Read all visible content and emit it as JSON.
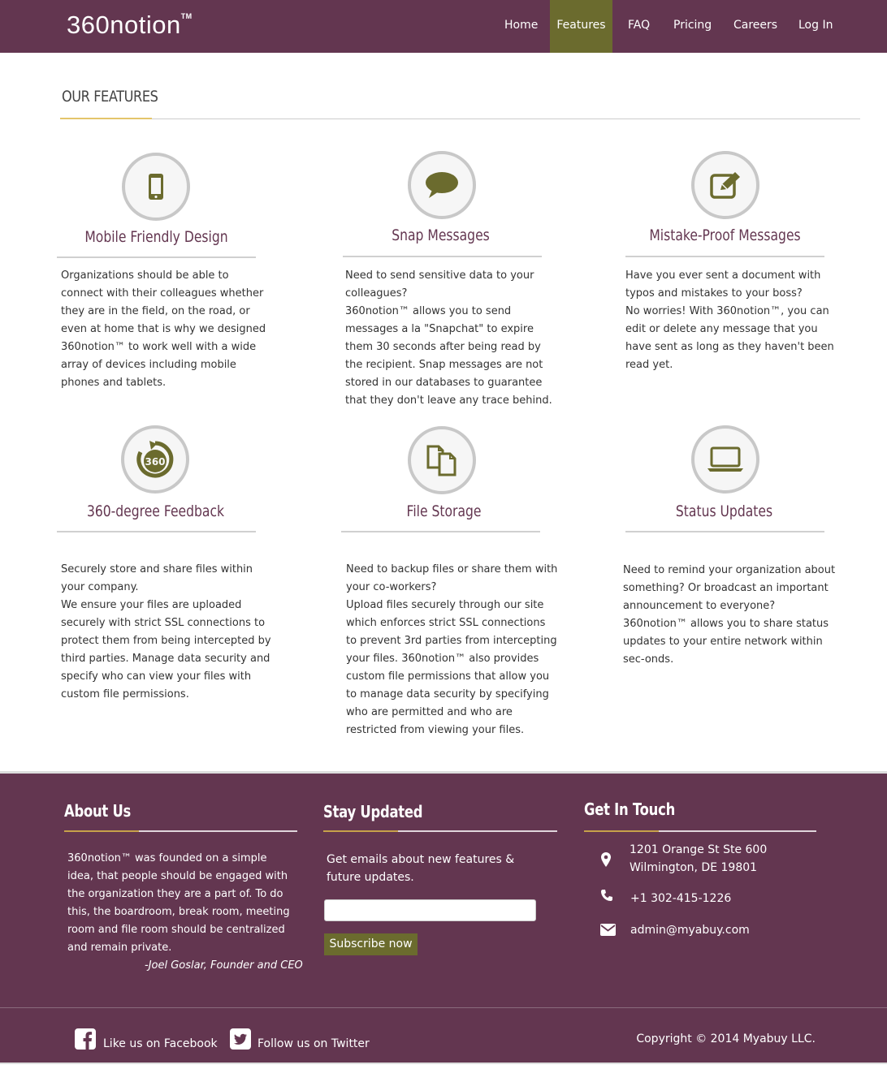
{
  "header": {
    "logo_text": "360notion",
    "logo_tm": "TM",
    "nav": [
      {
        "label": "Home"
      },
      {
        "label": "Features",
        "active": true
      },
      {
        "label": "FAQ"
      },
      {
        "label": "Pricing"
      },
      {
        "label": "Careers"
      },
      {
        "label": "Log In"
      }
    ]
  },
  "section_title": "OUR FEATURES",
  "features": [
    {
      "icon": "mobile-icon",
      "title": "Mobile Friendly Design",
      "text": [
        "Organizations should be able to connect with their colleagues whether they are in the field, on the road, or even at home that is why we designed 360notion™ to work well with a wide array of devices including mobile phones and tablets."
      ]
    },
    {
      "icon": "chat-bubble-icon",
      "title": "Snap Messages",
      "text": [
        "Need to send sensitive data to your colleagues?",
        "360notion™ allows you to send messages a la \"Snapchat\" to expire them 30 seconds after being read by the recipient. Snap messages are not stored in our databases to guarantee that they don't leave any trace behind."
      ]
    },
    {
      "icon": "edit-icon",
      "title": "Mistake-Proof Messages",
      "text": [
        "Have you ever sent a document with typos and mistakes to your boss?",
        "No worries! With 360notion™, you can edit or delete any message that you have sent as long as they haven't been read yet."
      ]
    },
    {
      "icon": "360-feedback-icon",
      "title": "360-degree Feedback",
      "text": [
        "Securely store and share files within your company.",
        "We ensure your files are uploaded securely with strict SSL connections to protect them from being intercepted by third parties. Manage data security and specify who can view your files with custom file permissions."
      ]
    },
    {
      "icon": "files-icon",
      "title": "File Storage",
      "text": [
        "Need to backup files or share them with your co-workers?",
        "Upload files securely through our site which enforces strict SSL connections to prevent 3rd parties from intercepting your files. 360notion™ also provides custom file permissions that allow you to manage data security by specifying who are permitted and who are restricted from viewing your files."
      ]
    },
    {
      "icon": "laptop-icon",
      "title": "Status Updates",
      "text": [
        "Need to remind your organization about something? Or broadcast an important announcement to everyone?",
        "360notion™ allows you to share status updates to your entire network within sec-onds."
      ]
    }
  ],
  "footer": {
    "about": {
      "title": "About Us",
      "text": "360notion™ was founded on a simple idea, that people should be engaged with the organization they are a part of. To do this, the boardroom, break room, meeting room and file room should be centralized and remain private.",
      "signature": "-Joel Goslar, Founder and CEO"
    },
    "updates": {
      "title": "Stay Updated",
      "text": "Get emails about new features & future updates.",
      "email_value": "",
      "button": "Subscribe now"
    },
    "contact": {
      "title": "Get In Touch",
      "address_line1": "1201 Orange St Ste 600",
      "address_line2": "Wilmington, DE 19801",
      "phone": "+1 302-415-1226",
      "email": "admin@myabuy.com"
    },
    "social": {
      "facebook": "Like us on Facebook",
      "twitter": "Follow us on Twitter"
    },
    "copyright": "Copyright © 2014 Myabuy LLC."
  },
  "colors": {
    "brand_purple": "#633650",
    "accent_olive": "#6b6b2e",
    "accent_gold": "#e4c56b"
  }
}
